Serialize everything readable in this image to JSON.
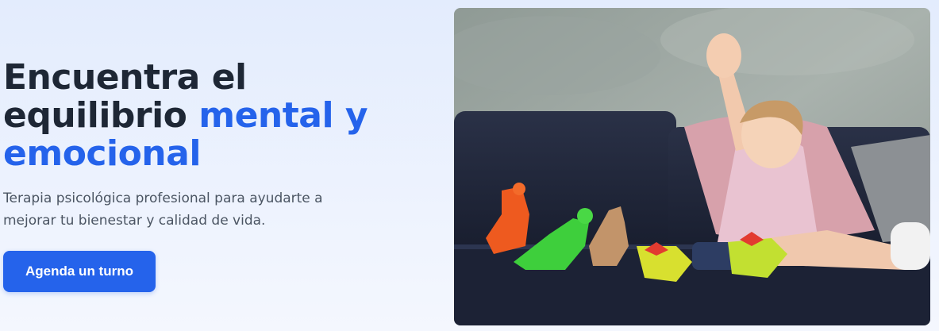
{
  "hero": {
    "headline_part1": "Encuentra el equilibrio ",
    "headline_accent": "mental y emocional",
    "subtitle": "Terapia psicológica profesional para ayudarte a mejorar tu bienestar y calidad de vida.",
    "cta_label": "Agenda un turno"
  },
  "colors": {
    "accent": "#2563eb",
    "heading": "#1e2735",
    "body_text": "#4b5563"
  }
}
